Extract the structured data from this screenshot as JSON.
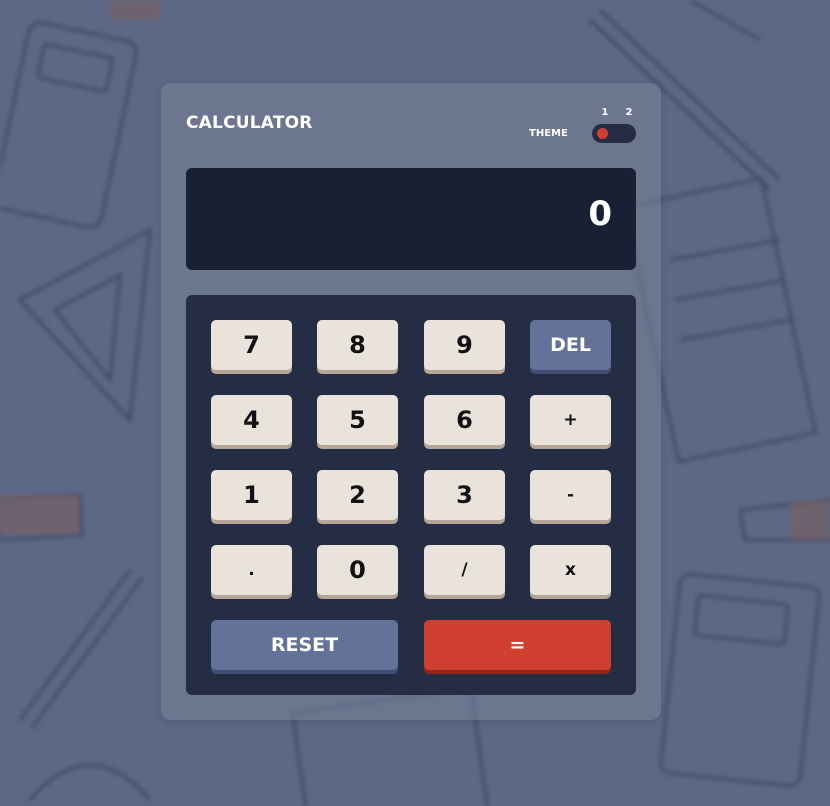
{
  "app": {
    "title": "CALCULATOR",
    "theme_label": "THEME",
    "theme_options": [
      "1",
      "2"
    ],
    "selected_theme": "1"
  },
  "display": {
    "value": "0"
  },
  "keys": {
    "row1": [
      "7",
      "8",
      "9",
      "DEL"
    ],
    "row2": [
      "4",
      "5",
      "6",
      "+"
    ],
    "row3": [
      "1",
      "2",
      "3",
      "-"
    ],
    "row4": [
      ".",
      "0",
      "/",
      "x"
    ],
    "reset": "RESET",
    "equals": "="
  },
  "colors": {
    "background": "#5d6886",
    "screen": "#182034",
    "keypad": "#242d44",
    "key": "#eae3dc",
    "key_shadow": "#b4a597",
    "accent_blue": "#647198",
    "accent_red": "#d03f2f"
  }
}
